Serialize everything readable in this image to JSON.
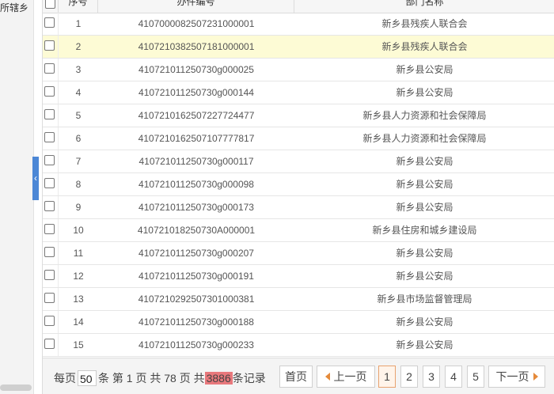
{
  "left_panel": {
    "label": "所辖乡"
  },
  "table": {
    "columns": {
      "seq": "序号",
      "case_no": "办件编号",
      "dept": "部门名称"
    },
    "rows": [
      {
        "seq": "1",
        "case_no": "410700008250723100000​1",
        "dept": "新乡县残疾人联合会"
      },
      {
        "seq": "2",
        "case_no": "410721038250718100000​1",
        "dept": "新乡县残疾人联合会"
      },
      {
        "seq": "3",
        "case_no": "410721011250730g000025",
        "dept": "新乡县公安局"
      },
      {
        "seq": "4",
        "case_no": "410721011250730g000144",
        "dept": "新乡县公安局"
      },
      {
        "seq": "5",
        "case_no": "410721016250722772447​7",
        "dept": "新乡县人力资源和社会保障局"
      },
      {
        "seq": "6",
        "case_no": "410721016250710777781​7",
        "dept": "新乡县人力资源和社会保障局"
      },
      {
        "seq": "7",
        "case_no": "410721011250730g000117",
        "dept": "新乡县公安局"
      },
      {
        "seq": "8",
        "case_no": "410721011250730g000098",
        "dept": "新乡县公安局"
      },
      {
        "seq": "9",
        "case_no": "410721011250730g000173",
        "dept": "新乡县公安局"
      },
      {
        "seq": "10",
        "case_no": "410721018250730A000001",
        "dept": "新乡县住房和城乡建设局"
      },
      {
        "seq": "11",
        "case_no": "410721011250730g000207",
        "dept": "新乡县公安局"
      },
      {
        "seq": "12",
        "case_no": "410721011250730g000191",
        "dept": "新乡县公安局"
      },
      {
        "seq": "13",
        "case_no": "410721029250730100038​1",
        "dept": "新乡县市场监督管理局"
      },
      {
        "seq": "14",
        "case_no": "410721011250730g000188",
        "dept": "新乡县公安局"
      },
      {
        "seq": "15",
        "case_no": "410721011250730g000233",
        "dept": "新乡县公安局"
      }
    ]
  },
  "pager": {
    "per_page_prefix": "每页",
    "per_page_value": "50",
    "per_page_suffix": "条 第",
    "current_page": "1",
    "page_of": "页 共",
    "total_pages": "78",
    "pages_total_suffix": "页 共",
    "total_records": "3886",
    "records_suffix": "条记录",
    "first": "首页",
    "prev": "上一页",
    "pages": [
      "1",
      "2",
      "3",
      "4",
      "5"
    ],
    "next": "下一页",
    "colors": {
      "active_border": "#e8a26f",
      "total_highlight": "#e8787c",
      "arrow": "#e58a3a"
    }
  },
  "colors": {
    "highlight_row": "#fdfbd5",
    "collapse_handle": "#4c87d6"
  }
}
